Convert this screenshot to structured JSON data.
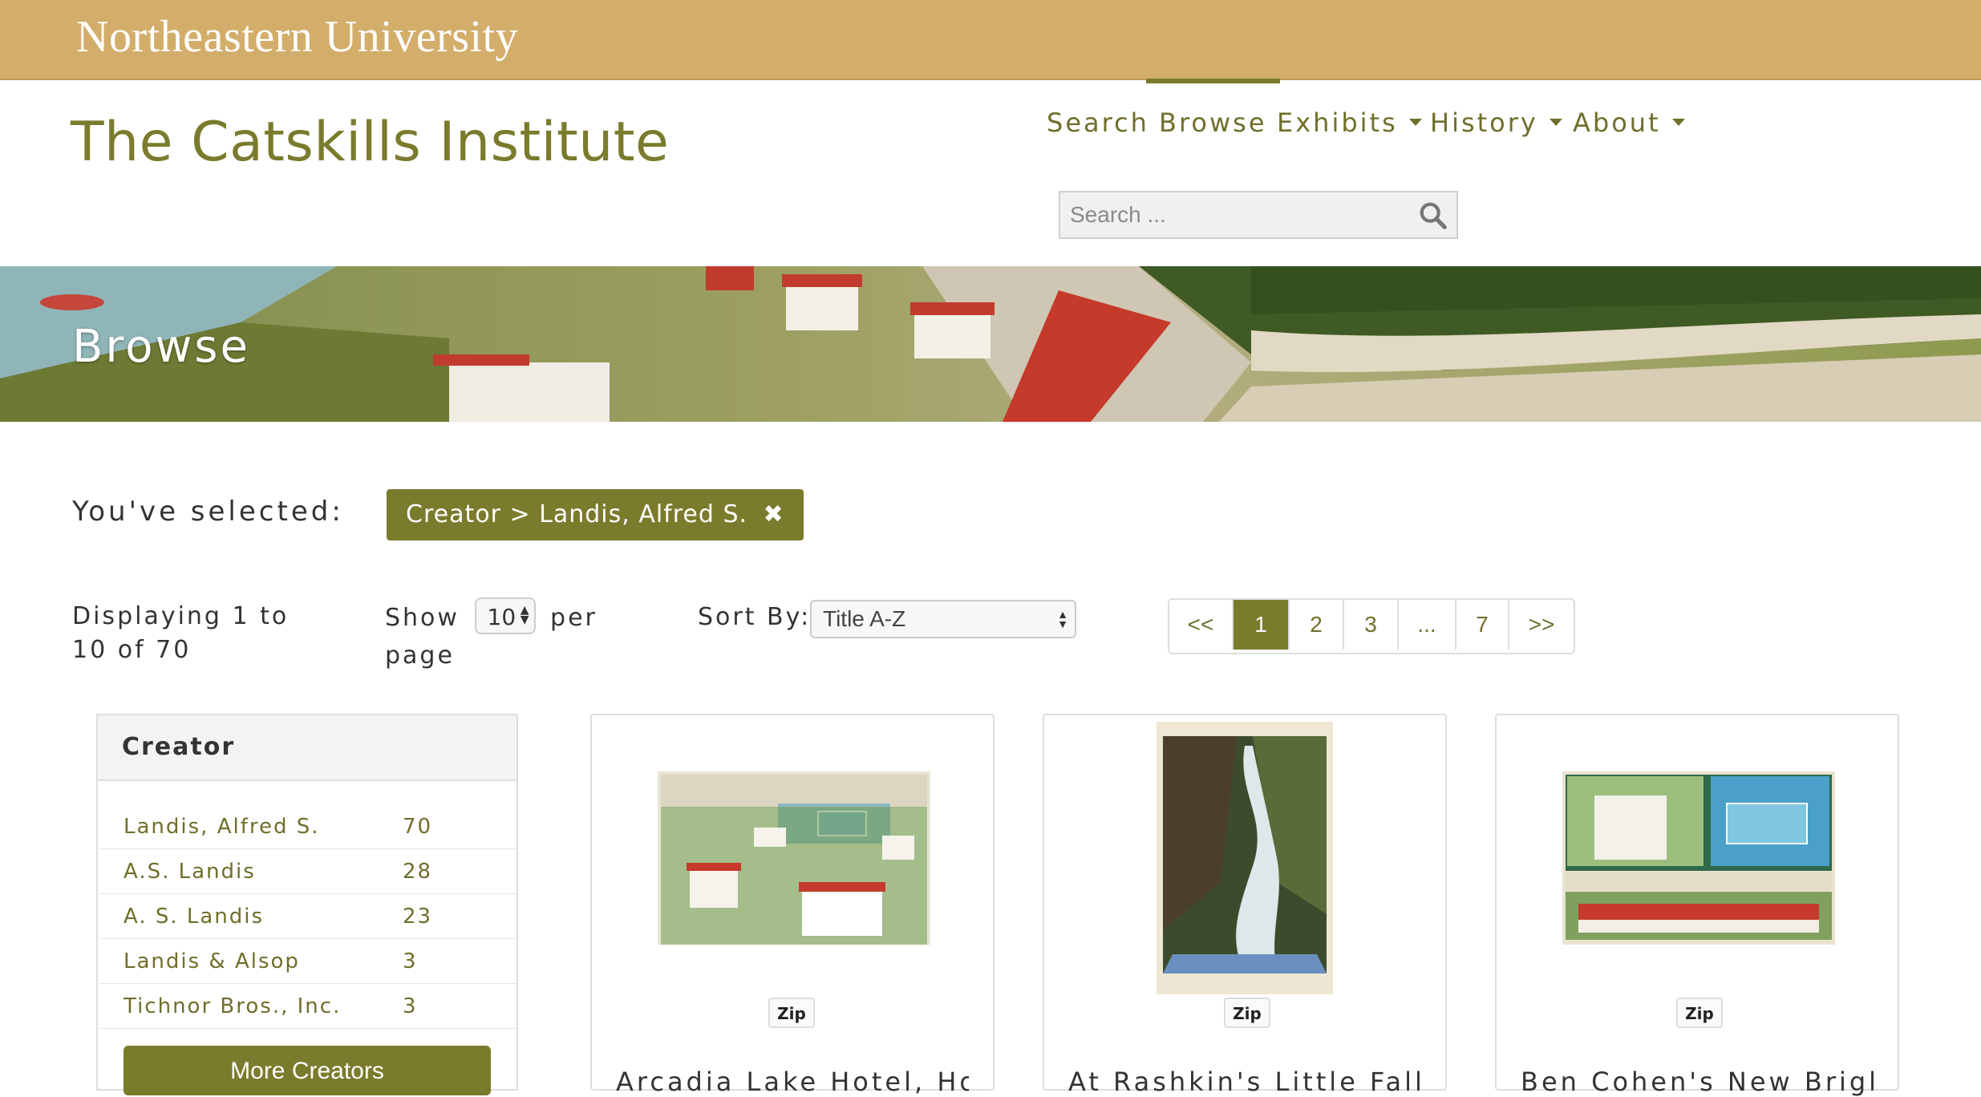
{
  "header": {
    "university": "Northeastern University",
    "site_title": "The Catskills Institute"
  },
  "nav": {
    "search": "Search",
    "browse": "Browse",
    "exhibits": "Exhibits",
    "history": "History",
    "about": "About"
  },
  "search": {
    "placeholder": "Search ..."
  },
  "banner": {
    "title": "Browse"
  },
  "filters": {
    "selected_label": "You've selected:",
    "chip": "Creator > Landis, Alfred S."
  },
  "controls": {
    "displaying": "Displaying 1 to 10 of 70",
    "show_before": "Show",
    "per_page": "10",
    "show_after": "per page",
    "sort_label": "Sort By:",
    "sort_value": "Title A-Z"
  },
  "pagination": [
    "<<",
    "1",
    "2",
    "3",
    "...",
    "7",
    ">>"
  ],
  "facet": {
    "title": "Creator",
    "items": [
      {
        "name": "Landis, Alfred S.",
        "count": "70"
      },
      {
        "name": "A.S. Landis",
        "count": "28"
      },
      {
        "name": "A. S. Landis",
        "count": "23"
      },
      {
        "name": "Landis & Alsop",
        "count": "3"
      },
      {
        "name": "Tichnor Bros., Inc.",
        "count": "3"
      }
    ],
    "more": "More Creators"
  },
  "cards": [
    {
      "zip": "Zip",
      "title": "Arcadia Lake Hotel, Ho"
    },
    {
      "zip": "Zip",
      "title": "At Rashkin's Little Falls"
    },
    {
      "zip": "Zip",
      "title": "Ben Cohen's New Brigh"
    }
  ],
  "colors": {
    "gold": "#d3ad6a",
    "olive": "#7a7b2c"
  }
}
